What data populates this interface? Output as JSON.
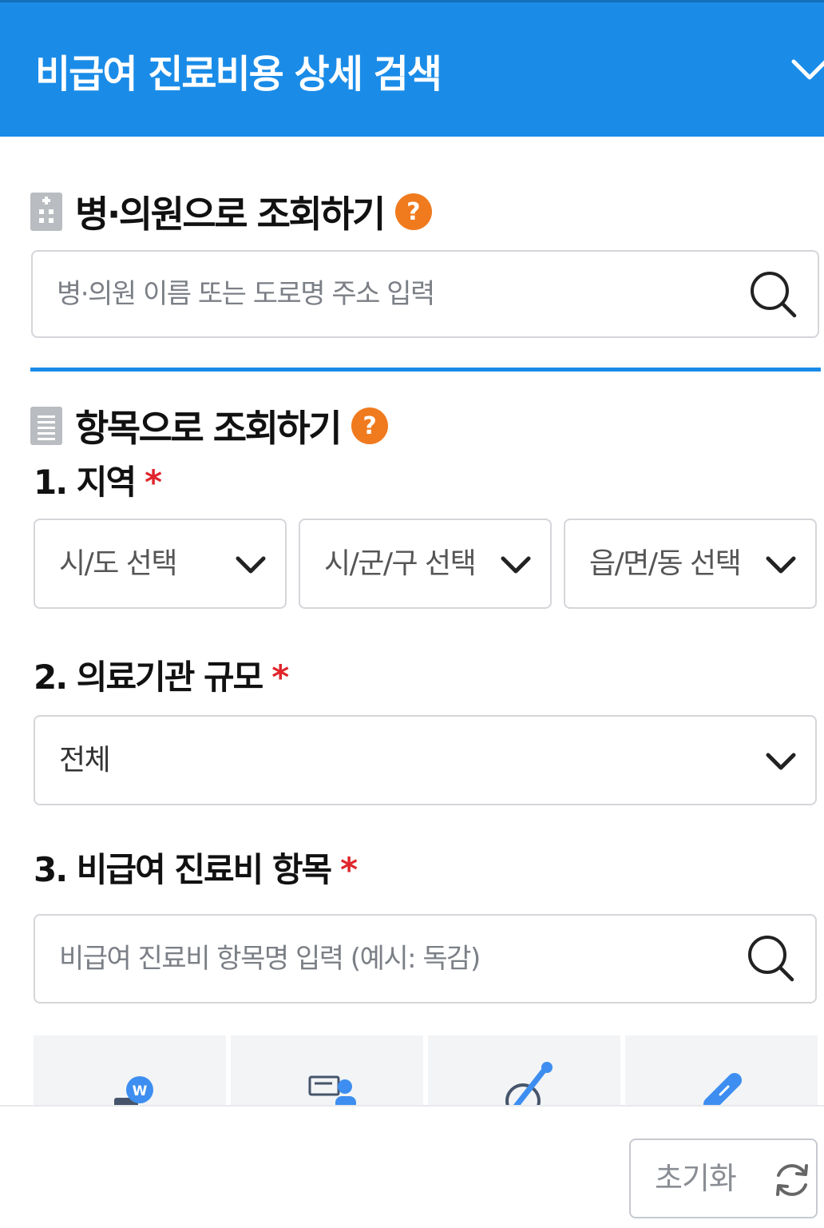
{
  "header": {
    "title": "비급여 진료비용 상세 검색",
    "chevron_icon": "chevron-down-icon"
  },
  "hospital_section": {
    "title": "병·의원으로 조회하기",
    "icon": "hospital-building-icon",
    "help": "?",
    "search": {
      "placeholder": "병·의원 이름 또는 도로명 주소 입력",
      "value": ""
    }
  },
  "item_section": {
    "title": "항목으로 조회하기",
    "icon": "document-list-icon",
    "help": "?",
    "region": {
      "label": "1. 지역",
      "required": "*",
      "selects": [
        "시/도 선택",
        "시/군/구 선택",
        "읍/면/동 선택"
      ]
    },
    "scale": {
      "label": "2. 의료기관 규모",
      "required": "*",
      "selected": "전체"
    },
    "item": {
      "label": "3. 비급여 진료비 항목",
      "required": "*",
      "search": {
        "placeholder": "비급여 진료비 항목명 입력 (예시: 독감)",
        "value": ""
      }
    },
    "category_icons": [
      "won-card-icon",
      "consultation-icon",
      "injection-icon",
      "capsule-icon"
    ]
  },
  "footer": {
    "reset_label": "초기화",
    "reset_icon": "refresh-icon"
  },
  "colors": {
    "primary": "#1a8ce8",
    "help": "#f07a1e",
    "required": "#e0262c",
    "border": "#d4d6da"
  }
}
